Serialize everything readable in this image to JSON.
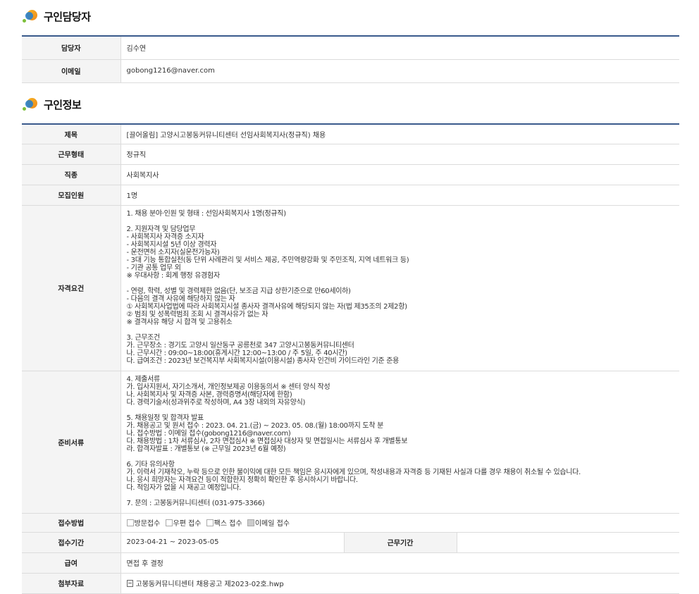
{
  "contact_section": {
    "title": "구인담당자",
    "rows": [
      {
        "label": "담당자",
        "value": "김수연"
      },
      {
        "label": "이메일",
        "value": "gobong1216@naver.com"
      }
    ]
  },
  "job_section": {
    "title": "구인정보",
    "title_row": {
      "label": "제목",
      "value": "[끌어올림] 고양시고봉동커뮤니티센터 선임사회복지사(정규직) 채용"
    },
    "employment_type": {
      "label": "근무형태",
      "value": "정규직"
    },
    "occupation": {
      "label": "직종",
      "value": "사회복지사"
    },
    "headcount": {
      "label": "모집인원",
      "value": "1명"
    },
    "qualifications": {
      "label": "자격요건",
      "value": "1. 채용 분야·인원 및 형태 : 선임사회복지사 1명(정규직)\n\n2. 지원자격 및 담당업무\n- 사회복지사 자격증 소지자\n- 사회복지시설 5년 이상 경력자\n- 운전면허 소지자(실운전가능자)\n- 3대 기능 통합실천(동 단위 사례관리 및 서비스 제공, 주민역량강화 및 주민조직, 지역 네트워크 등)\n- 기관 공통 업무 외\n※ 우대사항 : 회계 행정 유경험자\n\n- 연령, 학력, 성별 및 경력제한 없음(단, 보조금 지급 상한기준으로 만60세이하)\n- 다음의 결격 사유에 해당하지 않는 자\n① 사회복지사업법에 따라 사회복지시설 종사자 결격사유에 해당되지 않는 자(법 제35조의 2제2항)\n② 범죄 및 성폭력범죄 조회 시 결격사유가 없는 자\n※ 결격사유 해당 시 합격 및 고용취소\n\n3. 근무조건\n가. 근무장소 : 경기도 고양시 일산동구 공릉천로 347 고양시고봉동커뮤니티센터\n나. 근무시간 : 09:00~18:00(휴게시간 12:00~13:00 / 주 5일, 주 40시간)\n다. 급여조건 : 2023년 보건복지부 사회복지시설(이용시설) 종사자 인건비 가이드라인 기준 준용"
    },
    "documents": {
      "label": "준비서류",
      "value": "4. 제출서류\n가. 입사지원서, 자기소개서, 개인정보제공 이용동의서 ※ 센터 양식 작성\n나. 사회복지사 및 자격증 사본, 경력증명서(해당자에 한함)\n다. 경력기술서(성과위주로 작성하며, A4 3장 내외의 자유양식)\n\n5. 채용일정 및 합격자 발표\n가. 채용공고 및 원서 접수 : 2023. 04. 21.(금) ~ 2023. 05. 08.(월) 18:00까지 도착 분\n나. 접수방법 : 이메일 접수(gobong1216@naver.com)\n다. 채용방법 : 1차 서류심사, 2차 면접심사 ※ 면접심사 대상자 및 면접일시는 서류심사 후 개별통보\n라. 합격자발표 : 개별통보 (※ 근무일 2023년 6월 예정)\n\n6. 기타 유의사항\n가. 이력서 기재착오, 누락 등으로 인한 불이익에 대한 모든 책임은 응시자에게 있으며, 작성내용과 자격증 등 기재된 사실과 다를 경우 채용이 취소될 수 있습니다.\n나. 응시 희망자는 자격요건 등이 적합한지 정확히 확인한 후 응시하시기 바랍니다.\n다. 적임자가 없을 시 재공고 예정입니다.\n\n7. 문의 : 고봉동커뮤니티센터 (031-975-3366)"
    },
    "method": {
      "label": "접수방법",
      "options": [
        {
          "label": "방문접수",
          "checked": false
        },
        {
          "label": "우편 접수",
          "checked": false
        },
        {
          "label": "팩스 접수",
          "checked": false
        },
        {
          "label": "이메일 접수",
          "checked": true
        }
      ]
    },
    "period": {
      "label": "접수기간",
      "value": "2023-04-21 ~ 2023-05-05",
      "work_label": "근무기간",
      "work_value": ""
    },
    "salary": {
      "label": "급여",
      "value": "면접 후 결정"
    },
    "attachment": {
      "label": "첨부자료",
      "file": "고봉동커뮤니티센터 채용공고 제2023-02호.hwp",
      "icon": "file-icon"
    }
  }
}
